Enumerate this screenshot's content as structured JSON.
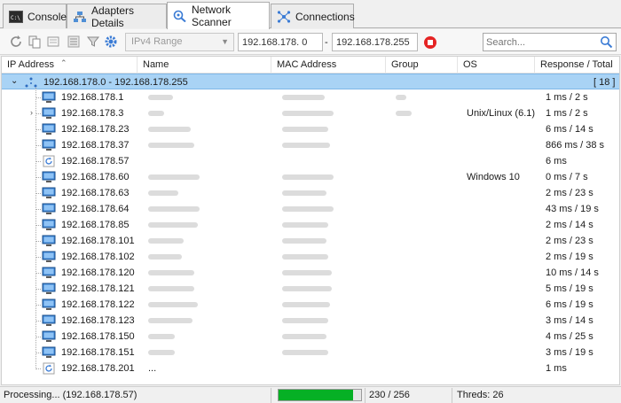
{
  "tabs": [
    {
      "label": "Console",
      "icon": "console-icon"
    },
    {
      "label": "Adapters Details",
      "icon": "adapters-icon"
    },
    {
      "label": "Network Scanner",
      "icon": "network-scanner-icon"
    },
    {
      "label": "Connections",
      "icon": "connections-icon"
    }
  ],
  "toolbar": {
    "range_type": "IPv4 Range",
    "start_ip": "192.168.178. 0",
    "end_ip": "192.168.178.255",
    "search_placeholder": "Search..."
  },
  "table": {
    "columns": [
      "IP Address",
      "Name",
      "MAC Address",
      "Group",
      "OS",
      "Response / Total"
    ],
    "group": {
      "label": "192.168.178.0 - 192.168.178.255",
      "count": "[ 18 ]"
    },
    "rows": [
      {
        "ip": "192.168.178.1",
        "os": "",
        "response": "1 ms / 2 s",
        "icon": "computer-icon"
      },
      {
        "ip": "192.168.178.3",
        "os": "Unix/Linux (6.1)",
        "response": "1 ms / 2 s",
        "icon": "computer-icon"
      },
      {
        "ip": "192.168.178.23",
        "os": "",
        "response": "6 ms / 14 s",
        "icon": "computer-icon"
      },
      {
        "ip": "192.168.178.37",
        "os": "",
        "response": "866 ms / 38 s",
        "icon": "computer-icon"
      },
      {
        "ip": "192.168.178.57",
        "os": "",
        "response": "6 ms",
        "icon": "refresh-icon"
      },
      {
        "ip": "192.168.178.60",
        "os": "Windows 10",
        "response": "0 ms / 7 s",
        "icon": "computer-icon"
      },
      {
        "ip": "192.168.178.63",
        "os": "",
        "response": "2 ms / 23 s",
        "icon": "computer-icon"
      },
      {
        "ip": "192.168.178.64",
        "os": "",
        "response": "43 ms / 19 s",
        "icon": "computer-icon"
      },
      {
        "ip": "192.168.178.85",
        "os": "",
        "response": "2 ms / 14 s",
        "icon": "computer-icon"
      },
      {
        "ip": "192.168.178.101",
        "os": "",
        "response": "2 ms / 23 s",
        "icon": "computer-icon"
      },
      {
        "ip": "192.168.178.102",
        "os": "",
        "response": "2 ms / 19 s",
        "icon": "computer-icon"
      },
      {
        "ip": "192.168.178.120",
        "os": "",
        "response": "10 ms / 14 s",
        "icon": "computer-icon"
      },
      {
        "ip": "192.168.178.121",
        "os": "",
        "response": "5 ms / 19 s",
        "icon": "computer-icon"
      },
      {
        "ip": "192.168.178.122",
        "os": "",
        "response": "6 ms / 19 s",
        "icon": "computer-icon"
      },
      {
        "ip": "192.168.178.123",
        "os": "",
        "response": "3 ms / 14 s",
        "icon": "computer-icon"
      },
      {
        "ip": "192.168.178.150",
        "os": "",
        "response": "4 ms / 25 s",
        "icon": "computer-icon"
      },
      {
        "ip": "192.168.178.151",
        "os": "",
        "response": "3 ms / 19 s",
        "icon": "computer-icon"
      },
      {
        "ip": "192.168.178.201",
        "name": "...",
        "os": "",
        "response": "1 ms",
        "icon": "refresh-icon"
      }
    ]
  },
  "status": {
    "processing": "Processing... (192.168.178.57)",
    "progress_fraction": 0.9,
    "count": "230 / 256",
    "threads": "Threds: 26"
  },
  "colors": {
    "group_row": "#a9d3f5",
    "progress_fill": "#06b025",
    "stop_button": "#e52424"
  }
}
